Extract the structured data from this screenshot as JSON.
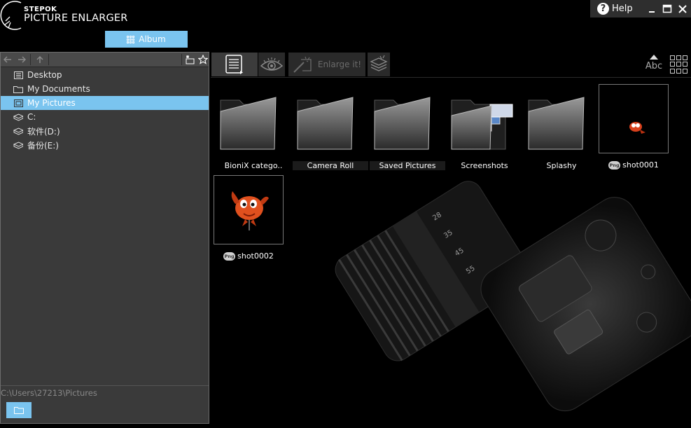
{
  "app": {
    "brand_top": "STEPOK",
    "brand_main": "PICTURE ENLARGER",
    "album_label": "Album"
  },
  "window": {
    "help_label": "Help",
    "help_glyph": "?",
    "minimize_glyph": "–",
    "maximize_glyph": "□",
    "close_glyph": "✕"
  },
  "tree": {
    "items": [
      {
        "label": "Desktop",
        "icon": "desktop-icon"
      },
      {
        "label": "My Documents",
        "icon": "folder-icon"
      },
      {
        "label": "My Pictures",
        "icon": "pictures-icon",
        "selected": true
      },
      {
        "label": "C:",
        "icon": "drive-icon"
      },
      {
        "label": "软件(D:)",
        "icon": "drive-icon"
      },
      {
        "label": "备份(E:)",
        "icon": "drive-icon"
      }
    ]
  },
  "footer": {
    "path": "C:\\Users\\27213\\Pictures"
  },
  "toolbar": {
    "enlarge_label": "Enlarge it!",
    "sort_label": "Abc"
  },
  "gallery": {
    "items": [
      {
        "name": "BioniX catego..",
        "kind": "folder"
      },
      {
        "name": "Camera Roll",
        "kind": "folder"
      },
      {
        "name": "Saved Pictures",
        "kind": "folder"
      },
      {
        "name": "Screenshots",
        "kind": "folder"
      },
      {
        "name": "Splashy",
        "kind": "folder"
      },
      {
        "name": "shot0001",
        "kind": "png"
      },
      {
        "name": "shot0002",
        "kind": "png"
      }
    ],
    "png_badge": "Png"
  },
  "colors": {
    "accent": "#7ac4ef",
    "panel": "#3a3a3a",
    "background": "#000000"
  }
}
